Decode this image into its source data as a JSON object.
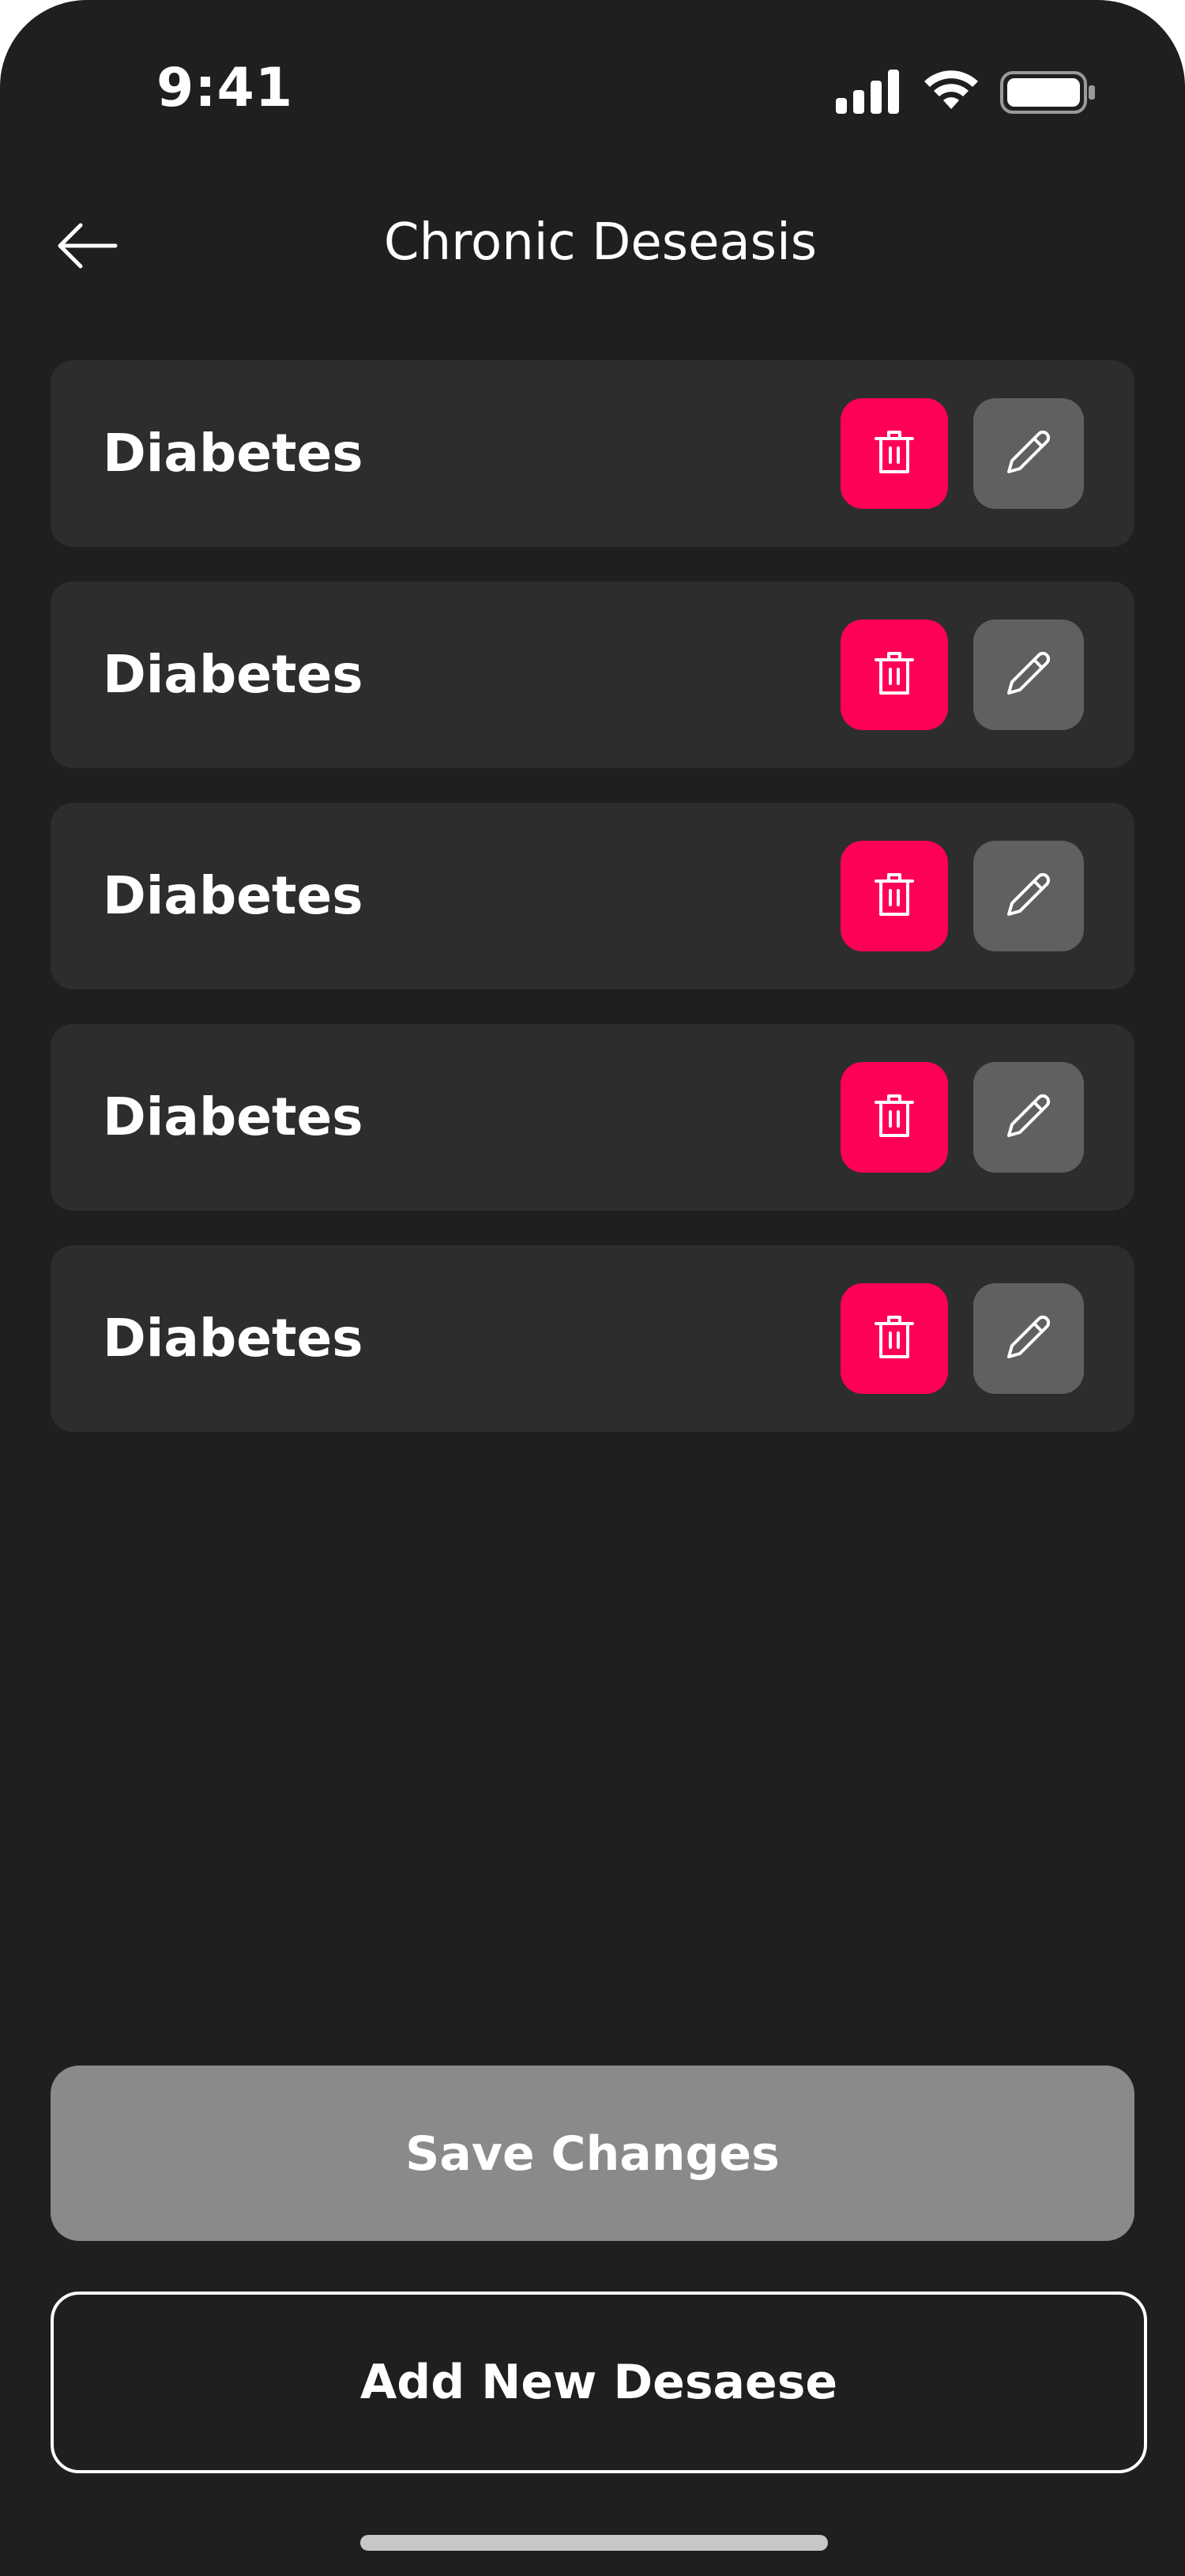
{
  "status_bar": {
    "time": "9:41"
  },
  "header": {
    "title": "Chronic Deseasis",
    "back_icon": "arrow-left-icon"
  },
  "diseases": [
    {
      "name": "Diabetes",
      "delete_icon": "trash-icon",
      "edit_icon": "pencil-icon"
    },
    {
      "name": "Diabetes",
      "delete_icon": "trash-icon",
      "edit_icon": "pencil-icon"
    },
    {
      "name": "Diabetes",
      "delete_icon": "trash-icon",
      "edit_icon": "pencil-icon"
    },
    {
      "name": "Diabetes",
      "delete_icon": "trash-icon",
      "edit_icon": "pencil-icon"
    },
    {
      "name": "Diabetes",
      "delete_icon": "trash-icon",
      "edit_icon": "pencil-icon"
    }
  ],
  "actions": {
    "save_label": "Save Changes",
    "add_label": "Add New Desaese"
  },
  "colors": {
    "background": "#1f1f21",
    "card": "#2d2d2f",
    "delete_accent": "#ff0057",
    "edit_button": "#606061",
    "save_button": "#8a8a8a"
  }
}
